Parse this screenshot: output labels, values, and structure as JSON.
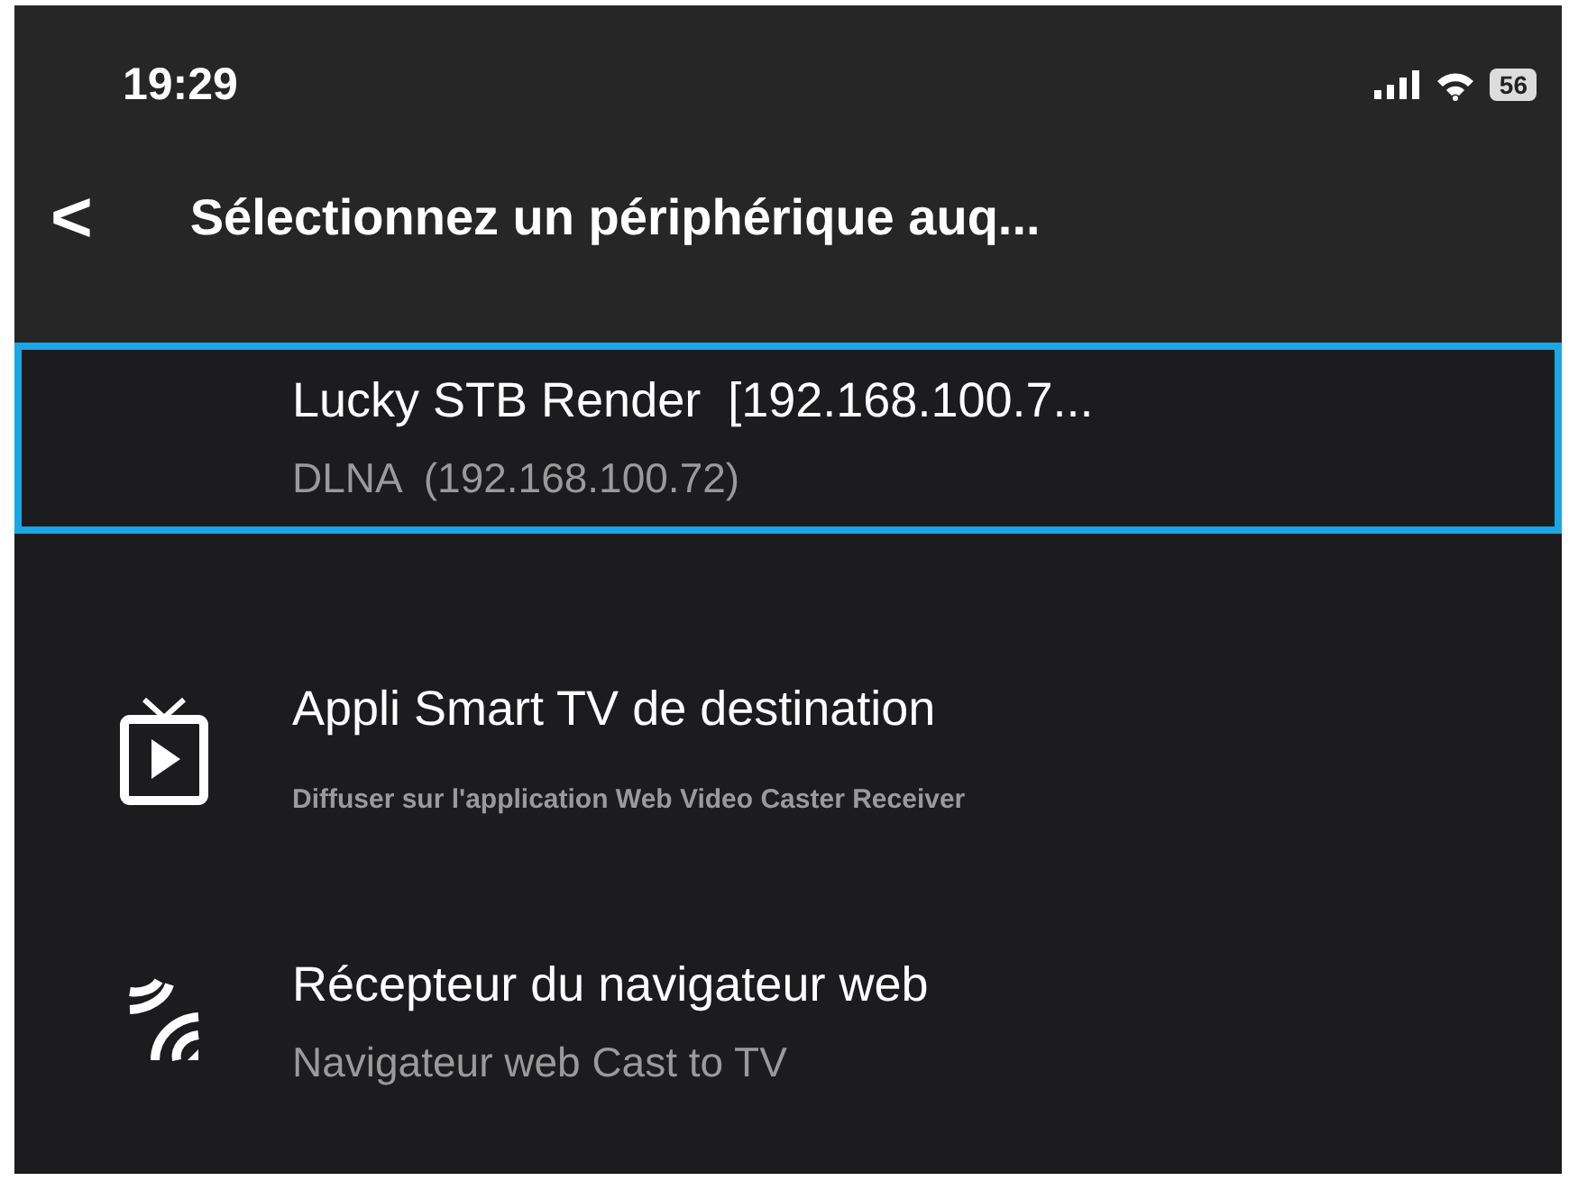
{
  "status_bar": {
    "time": "19:29",
    "battery": "56"
  },
  "nav": {
    "back": "<",
    "title": "Sélectionnez un périphérique auq..."
  },
  "devices": [
    {
      "kind": "none",
      "title": "Lucky STB Render  [192.168.100.7...",
      "subtitle": "DLNA  (192.168.100.72)",
      "selected": true
    },
    {
      "kind": "tv",
      "title": "Appli Smart TV de destination",
      "subtitle": "Diffuser sur l'application Web Video Caster Receiver",
      "selected": false
    },
    {
      "kind": "cast",
      "title": "Récepteur du navigateur web",
      "subtitle": "Navigateur web Cast to TV",
      "selected": false
    }
  ]
}
